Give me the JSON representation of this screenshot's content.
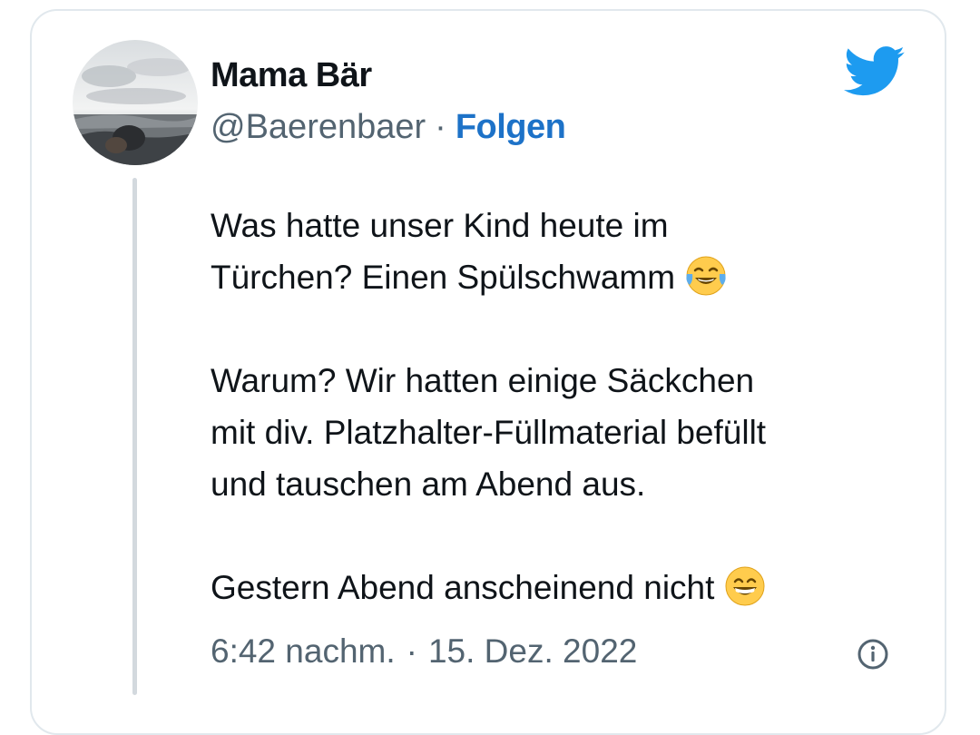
{
  "author": {
    "display_name": "Mama Bär",
    "handle": "@Baerenbaer",
    "separator": "·",
    "follow_label": "Folgen",
    "avatar": "avatar-photo"
  },
  "logo": "twitter-bird-icon",
  "tweet": {
    "paragraphs": [
      [
        "Was hatte unser Kind heute im",
        "Türchen? Einen Spülschwamm"
      ],
      [
        "Warum? Wir hatten einige Säckchen",
        "mit div. Platzhalter-Füllmaterial befüllt",
        "und tauschen am Abend aus."
      ],
      [
        "Gestern Abend anscheinend nicht"
      ]
    ],
    "emojis": [
      "tears-of-joy-emoji",
      "grinning-face-emoji"
    ]
  },
  "meta": {
    "time": "6:42 nachm.",
    "separator": "·",
    "date": "15. Dez. 2022",
    "info_icon": "info-icon"
  },
  "colors": {
    "link": "#1d72c8",
    "twitter_blue": "#1d9bf0",
    "muted_text": "#536471",
    "border": "#e1e8ed"
  }
}
